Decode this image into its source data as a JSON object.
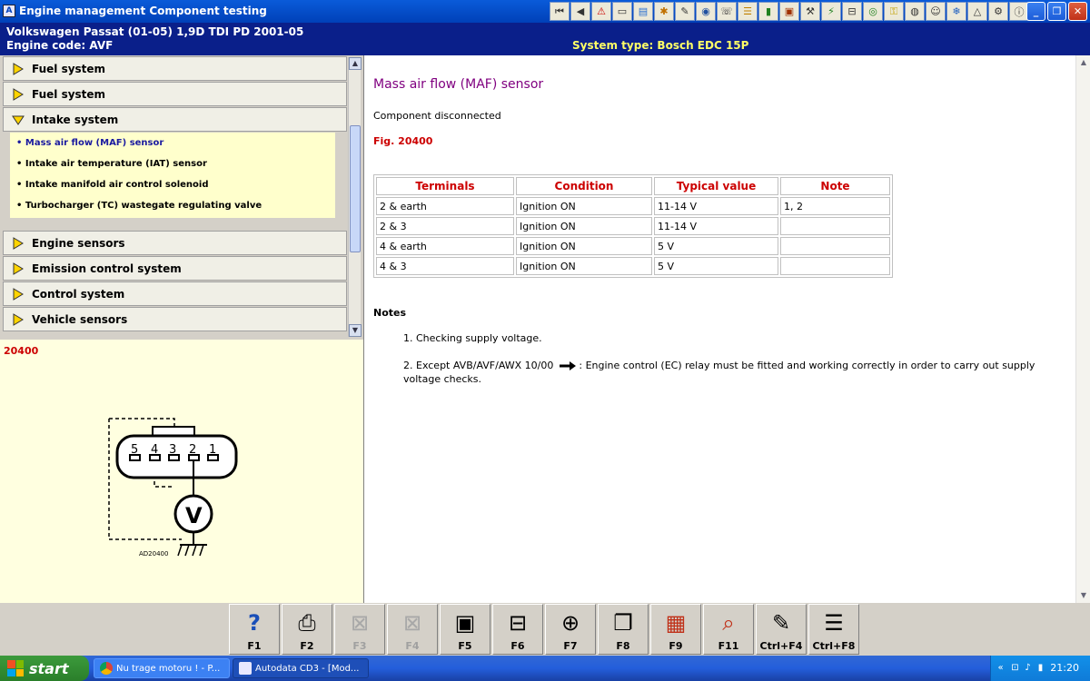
{
  "window": {
    "title": "Engine management Component testing"
  },
  "vehicle": {
    "make_model": "Volkswagen   Passat (01-05) 1,9D TDI PD 2001-05",
    "engine_code": "Engine code: AVF",
    "system_type": "System type: Bosch EDC 15P"
  },
  "nav": {
    "items": [
      {
        "label": "Fuel system"
      },
      {
        "label": "Fuel system"
      },
      {
        "label": "Intake system"
      },
      {
        "label": "Engine sensors"
      },
      {
        "label": "Emission control system"
      },
      {
        "label": "Control system"
      },
      {
        "label": "Vehicle sensors"
      }
    ],
    "subitems": [
      {
        "label": "•  Mass air flow (MAF) sensor"
      },
      {
        "label": "•  Intake air temperature (IAT) sensor"
      },
      {
        "label": "•  Intake manifold air control solenoid"
      },
      {
        "label": "•  Turbocharger (TC) wastegate regulating valve"
      }
    ]
  },
  "figure": {
    "number": "20400",
    "pins": [
      "5",
      "4",
      "3",
      "2",
      "1"
    ],
    "meter_label": "V",
    "code": "AD20400"
  },
  "content": {
    "title": "Mass air flow (MAF) sensor",
    "status": "Component disconnected",
    "fig_ref": "Fig. 20400",
    "table": {
      "headers": [
        "Terminals",
        "Condition",
        "Typical value",
        "Note"
      ],
      "rows": [
        [
          "2 & earth",
          "Ignition ON",
          "11-14 V",
          "1, 2"
        ],
        [
          "2 & 3",
          "Ignition ON",
          "11-14 V",
          ""
        ],
        [
          "4 & earth",
          "Ignition ON",
          "5 V",
          ""
        ],
        [
          "4 & 3",
          "Ignition ON",
          "5 V",
          ""
        ]
      ]
    },
    "notes_heading": "Notes",
    "note1": "1. Checking supply voltage.",
    "note2_prefix": "2. Except AVB/AVF/AWX 10/00",
    "note2_suffix": " : Engine control (EC) relay must be fitted and working correctly in order to carry out supply voltage checks."
  },
  "fkeys": [
    {
      "label": "F1",
      "icon": "help-icon",
      "enabled": true
    },
    {
      "label": "F2",
      "icon": "print-icon",
      "enabled": true
    },
    {
      "label": "F3",
      "icon": "disabled-tool-icon",
      "enabled": false
    },
    {
      "label": "F4",
      "icon": "disabled-tool-icon",
      "enabled": false
    },
    {
      "label": "F5",
      "icon": "component-icon",
      "enabled": true
    },
    {
      "label": "F6",
      "icon": "connector-icon",
      "enabled": true
    },
    {
      "label": "F7",
      "icon": "zoom-icon",
      "enabled": true
    },
    {
      "label": "F8",
      "icon": "book-icon",
      "enabled": true
    },
    {
      "label": "F9",
      "icon": "diagram-icon",
      "enabled": true
    },
    {
      "label": "F11",
      "icon": "search-icon",
      "enabled": true
    },
    {
      "label": "Ctrl+F4",
      "icon": "notes-icon",
      "enabled": true
    },
    {
      "label": "Ctrl+F8",
      "icon": "list-icon",
      "enabled": true
    }
  ],
  "taskbar": {
    "start_label": "start",
    "tasks": [
      {
        "label": "Nu trage motoru ! - P..."
      },
      {
        "label": "Autodata CD3 - [Mod..."
      }
    ],
    "clock": "21:20"
  },
  "colors": {
    "title_bar": "#0a5bd9",
    "vehicle_header": "#0a1f8a",
    "table_header": "#cc0000",
    "content_title": "#800080",
    "submenu_bg": "#ffffcc"
  }
}
